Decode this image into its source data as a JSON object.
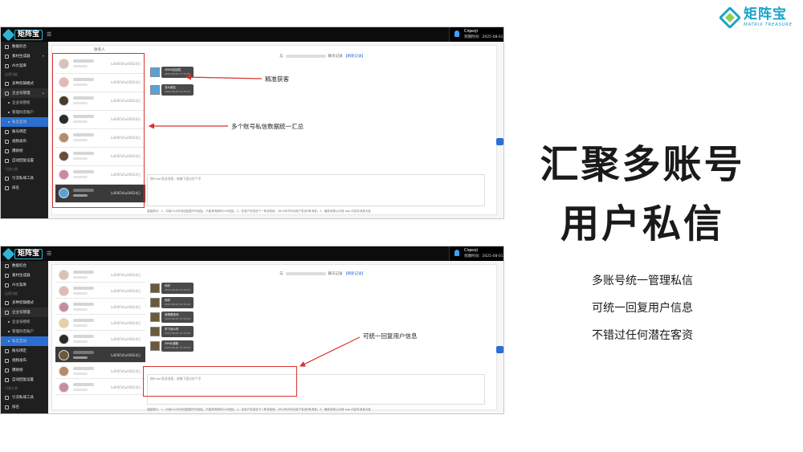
{
  "brand": {
    "name": "矩阵宝",
    "subtitle": "MATRIX TREASURE",
    "accent": "#1aa3c9"
  },
  "headline": {
    "line1": "汇聚多账号",
    "line2": "用户私信"
  },
  "bullets": [
    "多账号统一管理私信",
    "可统一回复用户信息",
    "不错过任何潜在客资"
  ],
  "app": {
    "logo": "矩阵宝",
    "user_name": "Ciqeoji",
    "user_date": "到期时间：2025-08-01",
    "sidebar_top": [
      {
        "label": "数据综合",
        "icon": "chart-icon"
      },
      {
        "label": "素材生成器",
        "icon": "media-icon"
      },
      {
        "label": "AI文案库",
        "icon": "ai-icon"
      }
    ],
    "sidebar_group": "运营功能",
    "sidebar_mid": [
      {
        "label": "多种剪辑模式",
        "icon": "scissors-icon"
      },
      {
        "label": "企业号管理",
        "icon": "account-icon"
      }
    ],
    "sidebar_sub": [
      "企业号授权",
      "管理抖音账户",
      "私信互动"
    ],
    "sidebar_after": [
      {
        "label": "账号绑定",
        "icon": "link-icon"
      },
      {
        "label": "视频发布",
        "icon": "upload-icon"
      },
      {
        "label": "爆款榜",
        "icon": "rank-icon"
      },
      {
        "label": "自动回复设置",
        "icon": "reply-icon"
      }
    ],
    "sidebar_group2": "引流工具",
    "sidebar_tail": [
      {
        "label": "引流私域工具",
        "icon": "tool-icon"
      },
      {
        "label": "排名",
        "icon": "trophy-icon"
      }
    ],
    "conv_title": "联系人",
    "chat_head_prefix": "与",
    "chat_head_suffix": "聊天记录",
    "chat_head_link": "【刷新记录】",
    "conv_time": "\\u0065d\\u0062d日",
    "input_placeholder": "按Enter发送消息，按着下面过好个字",
    "tips": "温馨提示：1、抖音24小时未回复图不可回复，只能有效期内24H回复；2、在用户未发送下一条消息前，48小时内可向用户发送5条消息；3、最新消息以抖音 app 内实际消息为准"
  },
  "shot1": {
    "messages": [
      {
        "text": "2M46名回答",
        "time": "2023-08-05 12:34:56"
      },
      {
        "text": "怎么报名",
        "time": "2023-08-05 12:35:10"
      }
    ],
    "callout_precise": "精准获客",
    "callout_summary": "多个账号私信数据统一汇总"
  },
  "shot2": {
    "messages": [
      {
        "text": "你好",
        "time": "2023-08-05 12:30:00"
      },
      {
        "text": "你好",
        "time": "2023-08-05 12:31:00"
      },
      {
        "text": "我想要咨询",
        "time": "2023-08-05 12:32:00"
      },
      {
        "text": "学习怎么样",
        "time": "2023-08-05 12:33:00"
      },
      {
        "text": "399元课程",
        "time": "2023-08-05 12:34:00"
      }
    ],
    "callout_reply": "可统一回复用户信息"
  }
}
